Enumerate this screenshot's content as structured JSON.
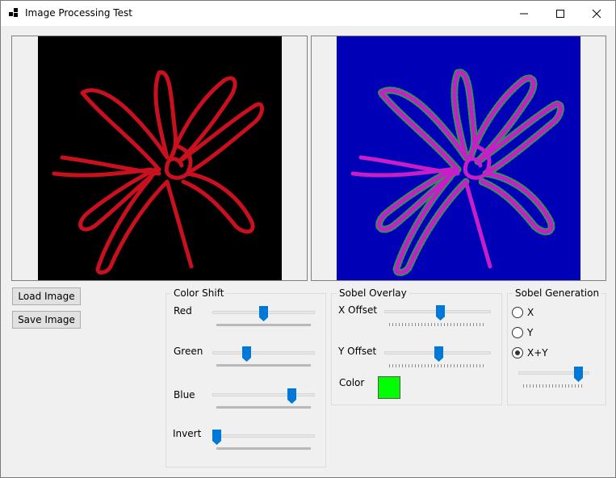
{
  "window": {
    "title": "Image Processing Test"
  },
  "buttons": {
    "load_label": "Load Image",
    "save_label": "Save Image"
  },
  "color_shift": {
    "legend": "Color Shift",
    "sliders": [
      {
        "label": "Red",
        "value": 0.5
      },
      {
        "label": "Green",
        "value": 0.32
      },
      {
        "label": "Blue",
        "value": 0.8
      },
      {
        "label": "Invert",
        "value": 0.0
      }
    ]
  },
  "sobel_overlay": {
    "legend": "Sobel Overlay",
    "x_label": "X Offset",
    "x_value": 0.53,
    "y_label": "Y Offset",
    "y_value": 0.51,
    "color_label": "Color",
    "color": "#00ff00"
  },
  "sobel_generation": {
    "legend": "Sobel Generation",
    "options": [
      {
        "label": "X",
        "checked": false
      },
      {
        "label": "Y",
        "checked": false
      },
      {
        "label": "X+Y",
        "checked": true
      }
    ],
    "slider_value": 0.9
  },
  "colors": {
    "source_bg": "#000000",
    "source_stroke": "#c8101e",
    "result_bg": "#0000b6",
    "result_stroke": "#c81ec8",
    "edge": "#2ea84a"
  }
}
